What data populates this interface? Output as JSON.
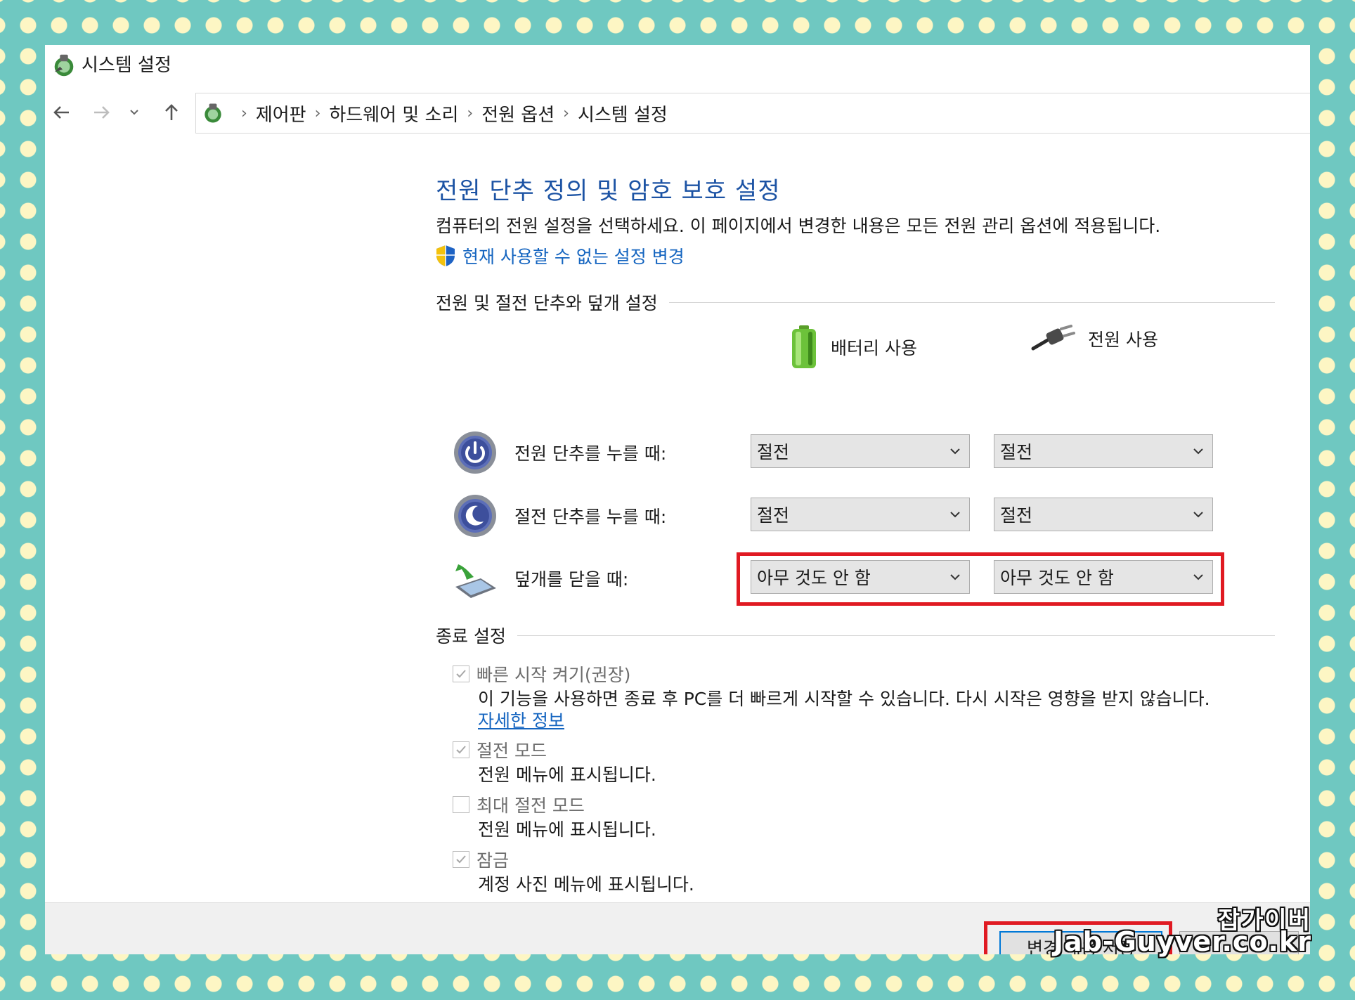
{
  "window": {
    "title": "시스템 설정"
  },
  "nav": {
    "back_icon": "arrow-left-icon",
    "forward_icon": "arrow-right-icon",
    "recent_icon": "chevron-down-icon",
    "up_icon": "arrow-up-icon",
    "breadcrumbs": [
      "제어판",
      "하드웨어 및 소리",
      "전원 옵션",
      "시스템 설정"
    ]
  },
  "main": {
    "title": "전원 단추 정의 및 암호 보호 설정",
    "description": "컴퓨터의 전원 설정을 선택하세요. 이 페이지에서 변경한 내용은 모든 전원 관리 옵션에 적용됩니다.",
    "uac_link": "현재 사용할 수 없는 설정 변경",
    "power_group_title": "전원 및 절전 단추와 덮개 설정",
    "columns": {
      "battery": "배터리 사용",
      "plugged": "전원 사용"
    },
    "rows": [
      {
        "label": "전원 단추를 누를 때:",
        "icon": "power-button-icon",
        "battery": "절전",
        "plugged": "절전"
      },
      {
        "label": "절전 단추를 누를 때:",
        "icon": "sleep-button-icon",
        "battery": "절전",
        "plugged": "절전"
      },
      {
        "label": "덮개를 닫을 때:",
        "icon": "laptop-lid-icon",
        "battery": "아무 것도 안 함",
        "plugged": "아무 것도 안 함"
      }
    ],
    "shutdown_group_title": "종료 설정",
    "shutdown_options": [
      {
        "label": "빠른 시작 켜기(권장)",
        "checked": true,
        "desc": "이 기능을 사용하면 종료 후 PC를 더 빠르게 시작할 수 있습니다. 다시 시작은 영향을 받지 않습니다.",
        "link": "자세한 정보"
      },
      {
        "label": "절전 모드",
        "checked": true,
        "desc": "전원 메뉴에 표시됩니다."
      },
      {
        "label": "최대 절전 모드",
        "checked": false,
        "desc": "전원 메뉴에 표시됩니다."
      },
      {
        "label": "잠금",
        "checked": true,
        "desc": "계정 사진 메뉴에 표시됩니다."
      }
    ]
  },
  "footer": {
    "save_label": "변경 내용 저장",
    "cancel_label": ""
  },
  "watermark": {
    "line1": "잡가이버",
    "line2": "Jab-Guyver.co.kr"
  },
  "colors": {
    "accent": "#1c53a4",
    "link": "#1565c0",
    "highlight": "#e01a22",
    "background": "#6fc8c1",
    "dots": "#fdf6c4"
  }
}
